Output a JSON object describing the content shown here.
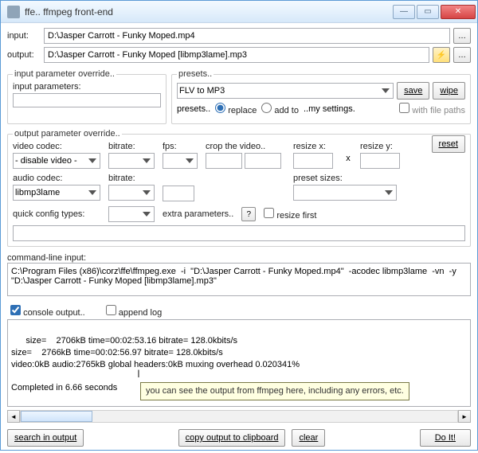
{
  "window": {
    "title": "ffe.. ffmpeg front-end"
  },
  "io": {
    "input_label": "input:",
    "input_value": "D:\\Jasper Carrott - Funky Moped.mp4",
    "output_label": "output:",
    "output_value": "D:\\Jasper Carrott - Funky Moped [libmp3lame].mp3"
  },
  "input_override": {
    "legend": "input parameter override..",
    "params_label": "input parameters:",
    "params_value": ""
  },
  "presets": {
    "legend": "presets..",
    "selected": "FLV to MP3",
    "save": "save",
    "wipe": "wipe",
    "prefix": "presets..",
    "replace": "replace",
    "addto": "add to",
    "suffix": "..my settings.",
    "withpaths": "with file paths"
  },
  "output_override": {
    "legend": "output parameter override..",
    "vcodec_label": "video codec:",
    "vcodec_value": "- disable video -",
    "bitrate_label": "bitrate:",
    "fps_label": "fps:",
    "crop_label": "crop the video..",
    "resizex_label": "resize x:",
    "resizey_label": "resize y:",
    "x_sep": "x",
    "acodec_label": "audio codec:",
    "acodec_value": "libmp3lame",
    "abitrate_label": "bitrate:",
    "preset_sizes_label": "preset sizes:",
    "quick_label": "quick config types:",
    "extra_label": "extra parameters..",
    "resize_first": "resize first",
    "reset": "reset"
  },
  "cmdline": {
    "label": "command-line input:",
    "value": "C:\\Program Files (x86)\\corz\\ffe\\ffmpeg.exe  -i  \"D:\\Jasper Carrott - Funky Moped.mp4\"  -acodec libmp3lame  -vn  -y  \"D:\\Jasper Carrott - Funky Moped [libmp3lame].mp3\""
  },
  "output": {
    "console_label": "console output..",
    "append_label": "append log",
    "text": "size=    2706kB time=00:02:53.16 bitrate= 128.0kbits/s\nsize=    2766kB time=00:02:56.97 bitrate= 128.0kbits/s\nvideo:0kB audio:2765kB global headers:0kB muxing overhead 0.020341%\n\nCompleted in 6.66 seconds",
    "tooltip": "you can see the output from ffmpeg here, including any errors, etc."
  },
  "footer": {
    "search": "search in output",
    "copy": "copy output to clipboard",
    "clear": "clear",
    "doit": "Do It!"
  }
}
